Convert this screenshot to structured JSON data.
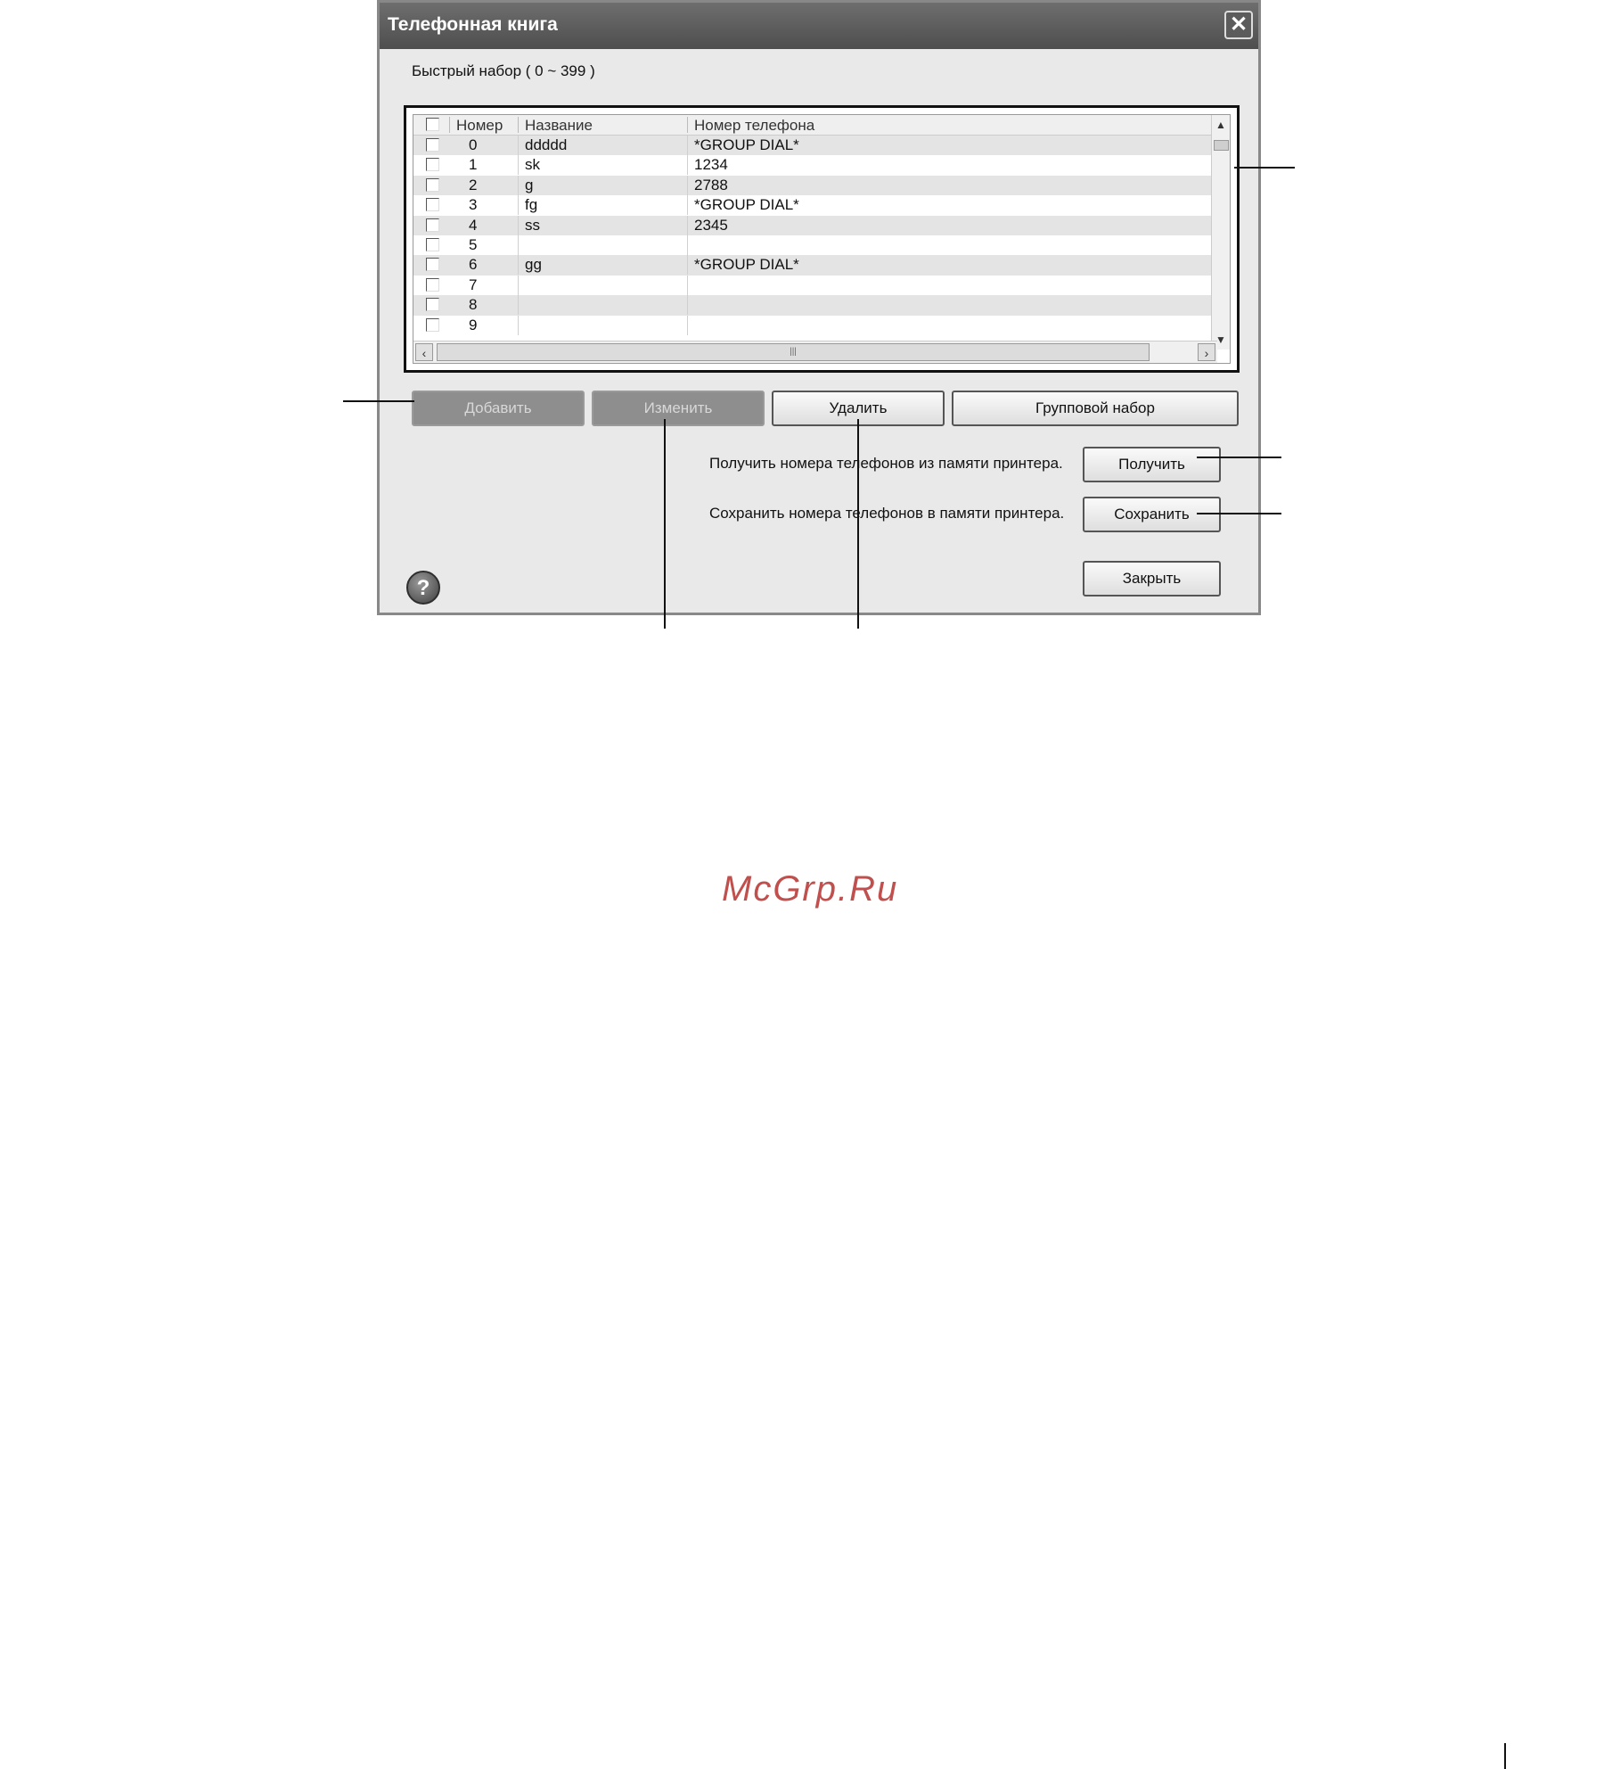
{
  "dialog": {
    "title": "Телефонная книга",
    "close_icon": "close-icon",
    "speed_dial_label": "Быстрый набор ( 0 ~ 399 )"
  },
  "grid": {
    "columns": [
      "Номер",
      "Название",
      "Номер телефона"
    ],
    "rows": [
      {
        "num": "0",
        "name": "ddddd",
        "phone": "*GROUP DIAL*"
      },
      {
        "num": "1",
        "name": "sk",
        "phone": "1234"
      },
      {
        "num": "2",
        "name": "g",
        "phone": "2788"
      },
      {
        "num": "3",
        "name": "fg",
        "phone": "*GROUP DIAL*"
      },
      {
        "num": "4",
        "name": "ss",
        "phone": "2345"
      },
      {
        "num": "5",
        "name": "",
        "phone": ""
      },
      {
        "num": "6",
        "name": "gg",
        "phone": "*GROUP DIAL*"
      },
      {
        "num": "7",
        "name": "",
        "phone": ""
      },
      {
        "num": "8",
        "name": "",
        "phone": ""
      },
      {
        "num": "9",
        "name": "",
        "phone": ""
      }
    ]
  },
  "buttons": {
    "add": "Добавить",
    "edit": "Изменить",
    "delete": "Удалить",
    "group_dial": "Групповой набор",
    "get": "Получить",
    "save": "Сохранить",
    "close": "Закрыть"
  },
  "descriptions": {
    "get_desc": "Получить номера телефонов из памяти принтера.",
    "save_desc": "Сохранить номера телефонов в памяти принтера."
  },
  "help_icon": "help-icon",
  "watermark": "McGrp.Ru"
}
